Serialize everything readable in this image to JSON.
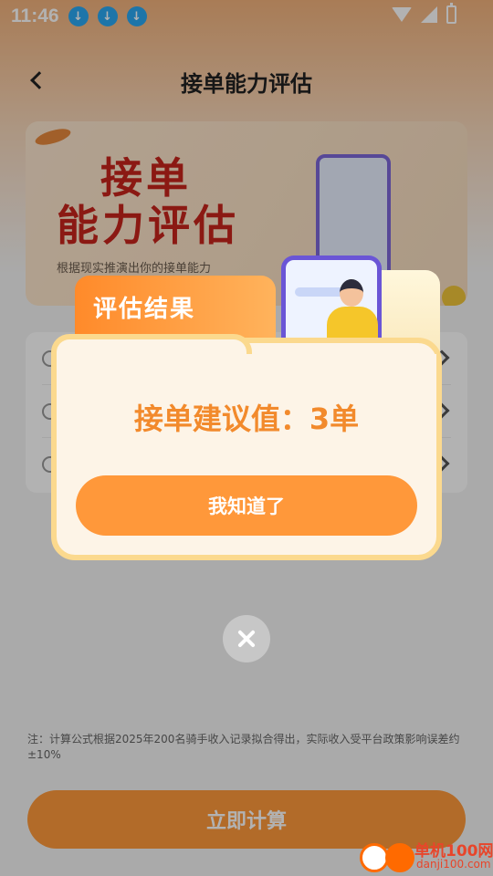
{
  "status_bar": {
    "time": "11:46",
    "download_icon_glyph": "↓"
  },
  "nav": {
    "title": "接单能力评估"
  },
  "banner": {
    "title_line1": "接单",
    "title_line2": "能力评估",
    "subtitle": "根据现实推演出你的接单能力"
  },
  "footnote": "注：计算公式根据2025年200名骑手收入记录拟合得出，实际收入受平台政策影响误差约±10%",
  "calculate_button": "立即计算",
  "dialog": {
    "tab_label": "评估结果",
    "suggestion": "接单建议值：3单",
    "ok_button": "我知道了"
  },
  "watermark": {
    "name": "单机100网",
    "url": "danji100.com"
  },
  "colors": {
    "accent": "#ff983a",
    "suggestion_text": "#f28a2c",
    "banner_title": "#c8241c"
  }
}
